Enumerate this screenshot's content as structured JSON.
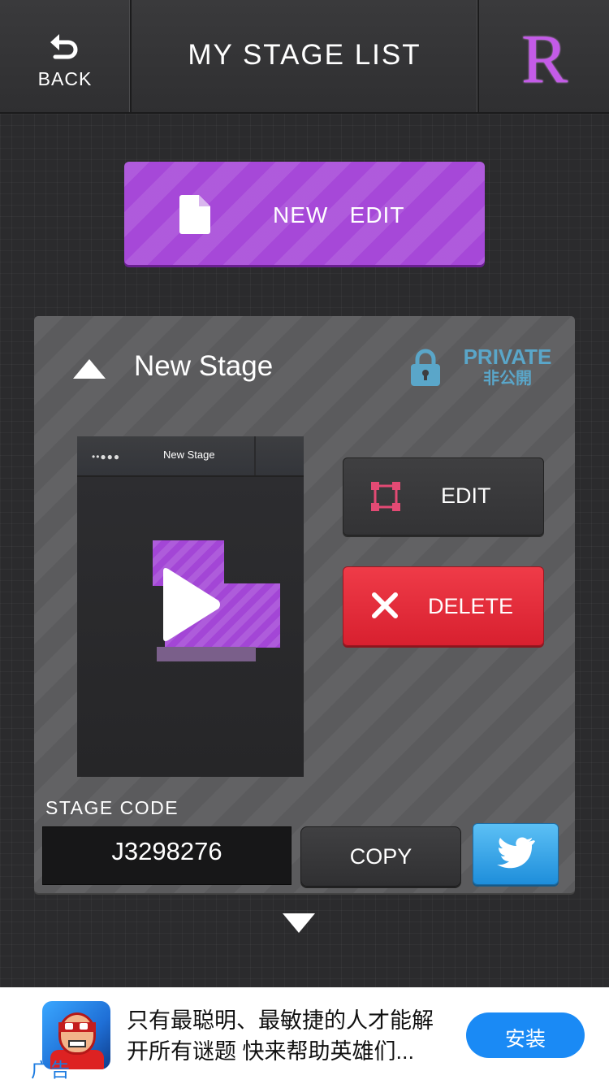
{
  "header": {
    "back_label": "BACK",
    "title": "MY STAGE LIST",
    "logo_text": "R"
  },
  "new_edit": {
    "label": "NEW   EDIT"
  },
  "stage_card": {
    "name": "New Stage",
    "visibility": {
      "en": "PRIVATE",
      "jp": "非公開"
    },
    "thumbnail": {
      "dots": "••●●●",
      "title": "New Stage"
    },
    "edit_label": "EDIT",
    "delete_label": "DELETE",
    "code_label": "STAGE CODE",
    "code_value": "J3298276",
    "copy_label": "COPY"
  },
  "colors": {
    "accent_purple": "#a648d8",
    "delete_red": "#e02b39",
    "twitter_blue": "#2f9ee6",
    "private_blue": "#5aa6c9"
  },
  "ad": {
    "tag": "广告",
    "text": "只有最聪明、最敏捷的人才能解开所有谜题 快来帮助英雄们...",
    "button": "安装"
  }
}
